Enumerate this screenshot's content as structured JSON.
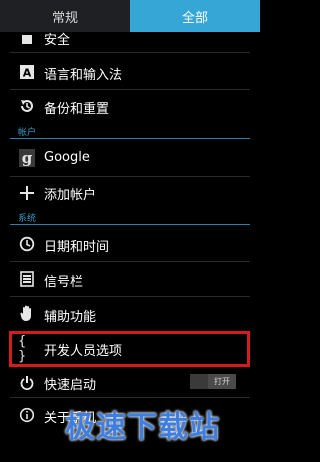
{
  "tabs": {
    "normal": "常规",
    "all": "全部"
  },
  "items": {
    "security": "安全",
    "language": "语言和输入法",
    "backup": "备份和重置",
    "google": "Google",
    "add_account": "添加帐户",
    "date_time": "日期和时间",
    "signal_bar": "信号栏",
    "accessibility": "辅助功能",
    "developer": "开发人员选项",
    "quick_boot": "快速启动",
    "about": "关于手机"
  },
  "sections": {
    "accounts": "帐户",
    "system": "系统"
  },
  "quick_boot_toggle": "打开",
  "watermark": "极速下载站",
  "colors": {
    "accent": "#35a6d6",
    "section": "#3c9ac9",
    "highlight": "#d61b1f",
    "watermark": "#3d7ee0"
  }
}
